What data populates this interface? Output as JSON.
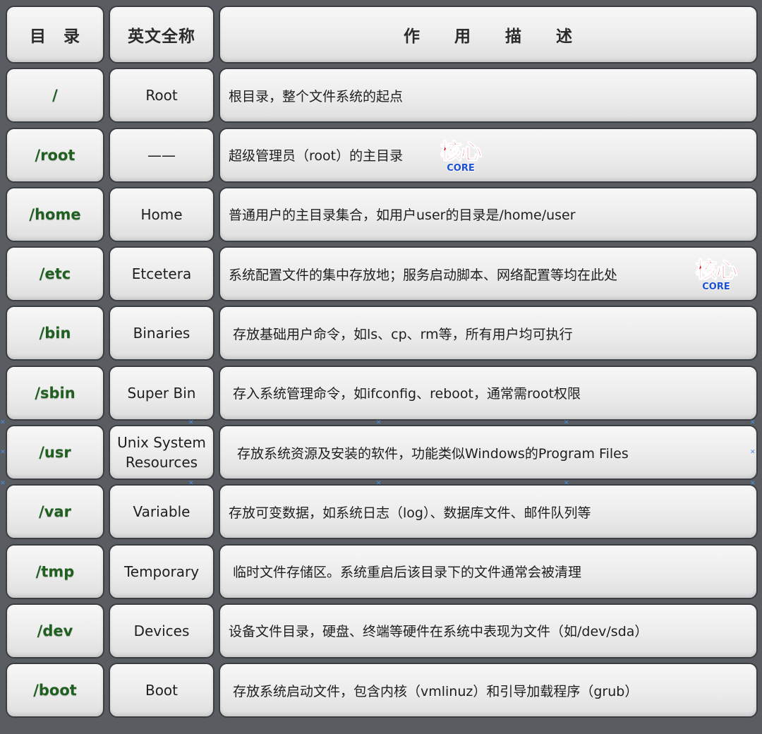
{
  "header": {
    "col_dir": "目　录",
    "col_en": "英文全称",
    "col_desc": "作　　用　　描　　述"
  },
  "rows": [
    {
      "dir": "/",
      "en": "Root",
      "desc": "根目录，整个文件系统的起点"
    },
    {
      "dir": "/root",
      "en": "——",
      "desc": "超级管理员（root）的主目录"
    },
    {
      "dir": "/home",
      "en": "Home",
      "desc": "普通用户的主目录集合，如用户user的目录是/home/user"
    },
    {
      "dir": "/etc",
      "en": "Etcetera",
      "desc": "系统配置文件的集中存放地；服务启动脚本、网络配置等均在此处"
    },
    {
      "dir": "/bin",
      "en": "Binaries",
      "desc": "存放基础用户命令，如ls、cp、rm等，所有用户均可执行"
    },
    {
      "dir": "/sbin",
      "en": "Super Bin",
      "desc": "存入系统管理命令，如ifconfig、reboot，通常需root权限"
    },
    {
      "dir": "/usr",
      "en": "Unix System\nResources",
      "desc": "存放系统资源及安装的软件，功能类似Windows的Program Files"
    },
    {
      "dir": "/var",
      "en": "Variable",
      "desc": "存放可变数据，如系统日志（log）、数据库文件、邮件队列等"
    },
    {
      "dir": "/tmp",
      "en": "Temporary",
      "desc": "临时文件存储区。系统重启后该目录下的文件通常会被清理"
    },
    {
      "dir": "/dev",
      "en": "Devices",
      "desc": "设备文件目录，硬盘、终端等硬件在系统中表现为文件（如/dev/sda）"
    },
    {
      "dir": "/boot",
      "en": "Boot",
      "desc": "存放系统启动文件，包含内核（vmlinuz）和引导加载程序（grub）"
    }
  ],
  "badge": {
    "big": "核心",
    "small": "CORE"
  },
  "colors": {
    "dir_text": "#1f5f1f",
    "badge_red": "#d01212",
    "badge_blue": "#1b4fd6"
  }
}
